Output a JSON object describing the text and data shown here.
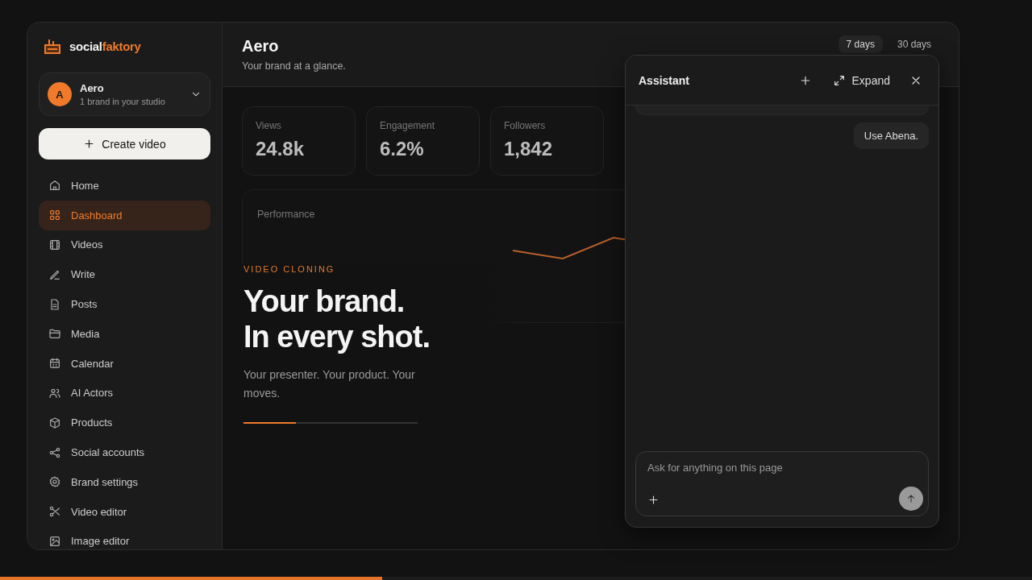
{
  "logo": {
    "text_start": "social",
    "text_end": "faktory"
  },
  "workspace": {
    "initial": "A",
    "name": "Aero",
    "subtitle": "1 brand in your studio"
  },
  "create_button": {
    "label": "Create video"
  },
  "nav": [
    {
      "label": "Home",
      "selected": false
    },
    {
      "label": "Dashboard",
      "selected": true
    },
    {
      "label": "Videos",
      "selected": false
    },
    {
      "label": "Write",
      "selected": false
    },
    {
      "label": "Posts",
      "selected": false
    },
    {
      "label": "Media",
      "selected": false
    },
    {
      "label": "Calendar",
      "selected": false
    },
    {
      "label": "AI Actors",
      "selected": false
    },
    {
      "label": "Products",
      "selected": false
    },
    {
      "label": "Social accounts",
      "selected": false
    },
    {
      "label": "Brand settings",
      "selected": false
    },
    {
      "label": "Video editor",
      "selected": false
    },
    {
      "label": "Image editor",
      "selected": false
    }
  ],
  "header": {
    "title": "Aero",
    "subtitle": "Your brand at a glance.",
    "ranges": [
      {
        "label": "7 days",
        "selected": true
      },
      {
        "label": "30 days",
        "selected": false
      }
    ]
  },
  "stats": [
    {
      "label": "Views",
      "value": "24.8k"
    },
    {
      "label": "Engagement",
      "value": "6.2%"
    },
    {
      "label": "Followers",
      "value": "1,842"
    }
  ],
  "performance": {
    "title": "Performance"
  },
  "promo": {
    "eyebrow": "VIDEO CLONING",
    "headline_lines": [
      "Your brand.",
      "In every shot."
    ],
    "body": "Your presenter. Your product. Your moves.",
    "level": 0.3
  },
  "assistant": {
    "title": "Assistant",
    "expand_label": "Expand",
    "messages": [
      {
        "kind": "user",
        "text": "Use Abena."
      }
    ],
    "input": {
      "placeholder": "Ask for anything on this page"
    }
  },
  "video_progress": {
    "level": 0.37
  }
}
